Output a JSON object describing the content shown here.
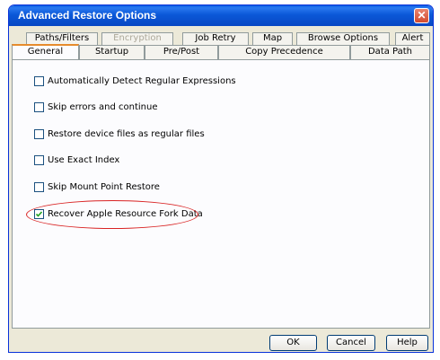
{
  "window": {
    "title": "Advanced Restore Options",
    "close_label": "✕"
  },
  "tabs_back": [
    {
      "label": "Paths/Filters",
      "disabled": false
    },
    {
      "label": "Encryption",
      "disabled": true
    },
    {
      "label": "Job Retry",
      "disabled": false
    },
    {
      "label": "Map",
      "disabled": false
    },
    {
      "label": "Browse Options",
      "disabled": false
    },
    {
      "label": "Alert",
      "disabled": false
    }
  ],
  "tabs_front": [
    {
      "label": "General",
      "active": true
    },
    {
      "label": "Startup",
      "active": false
    },
    {
      "label": "Pre/Post",
      "active": false
    },
    {
      "label": "Copy Precedence",
      "active": false
    },
    {
      "label": "Data Path",
      "active": false
    }
  ],
  "options": [
    {
      "label": "Automatically Detect Regular Expressions",
      "checked": false
    },
    {
      "label": "Skip errors and continue",
      "checked": false
    },
    {
      "label": "Restore device files as regular files",
      "checked": false
    },
    {
      "label": "Use Exact Index",
      "checked": false
    },
    {
      "label": "Skip Mount Point Restore",
      "checked": false
    },
    {
      "label": "Recover Apple Resource Fork Data",
      "checked": true
    }
  ],
  "buttons": {
    "ok": "OK",
    "cancel": "Cancel",
    "help": "Help"
  },
  "colors": {
    "highlight": "#d92323",
    "titlebar": "#0b58d8",
    "active_tab_accent": "#e68b2c"
  }
}
